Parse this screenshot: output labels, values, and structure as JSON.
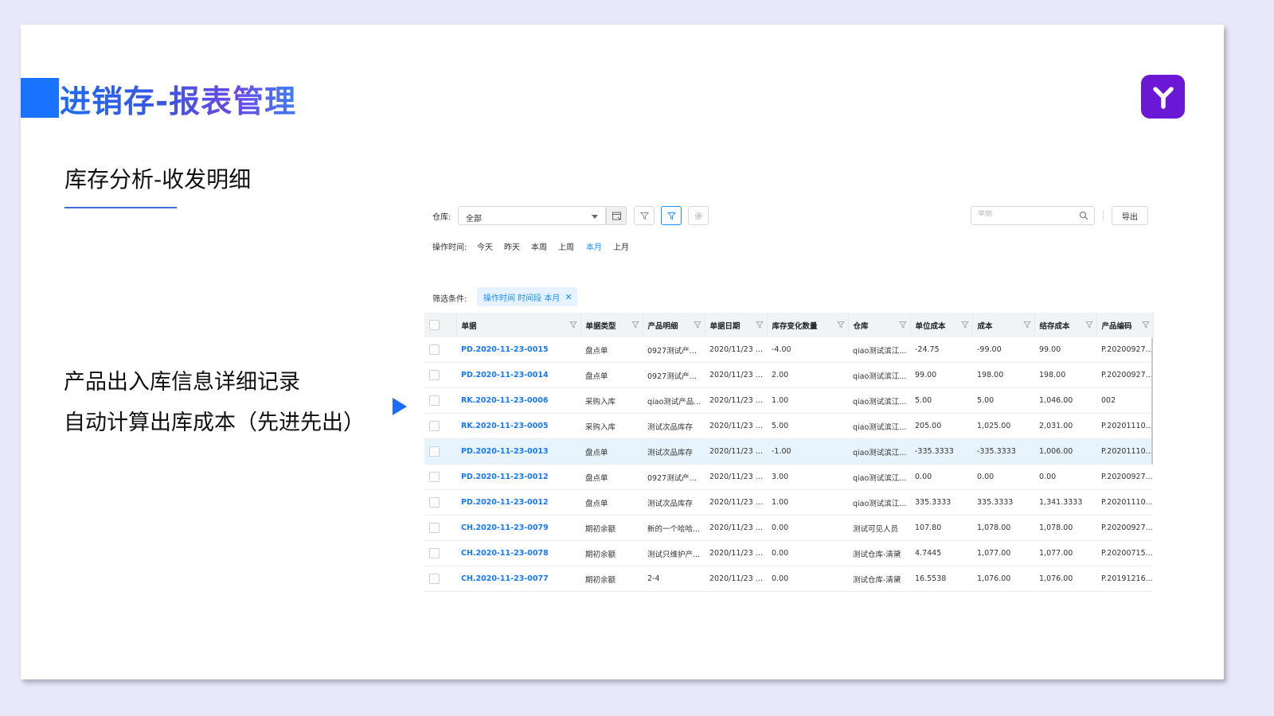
{
  "slide": {
    "title": "进销存-报表管理",
    "subtitle": "库存分析-收发明细",
    "desc_lines": [
      "产品出入库信息详细记录",
      "自动计算出库成本（先进先出）"
    ],
    "logo_icon": "y-logo-icon"
  },
  "toolbar": {
    "warehouse_label": "仓库:",
    "warehouse_value": "全部",
    "search_placeholder": "单据",
    "export_label": "导出"
  },
  "time_filter": {
    "label": "操作时间:",
    "options": [
      "今天",
      "昨天",
      "本周",
      "上周",
      "本月",
      "上月"
    ],
    "selected": "本月"
  },
  "filter": {
    "label": "筛选条件:",
    "tag": "操作时间 时间段 本月"
  },
  "table": {
    "headers": [
      "单据",
      "单据类型",
      "产品明细",
      "单据日期",
      "库存变化数量",
      "仓库",
      "单位成本",
      "成本",
      "结存成本",
      "产品编码"
    ],
    "rows": [
      {
        "no": "PD.2020-11-23-0015",
        "type": "盘点单",
        "product": "0927测试产...",
        "date": "2020/11/23 ...",
        "qty": "-4.00",
        "warehouse": "qiao测试滨江...",
        "unit_cost": "-24.75",
        "cost": "-99.00",
        "balance": "99.00",
        "code": "P.20200927..."
      },
      {
        "no": "PD.2020-11-23-0014",
        "type": "盘点单",
        "product": "0927测试产...",
        "date": "2020/11/23 ...",
        "qty": "2.00",
        "warehouse": "qiao测试滨江...",
        "unit_cost": "99.00",
        "cost": "198.00",
        "balance": "198.00",
        "code": "P.20200927..."
      },
      {
        "no": "RK.2020-11-23-0006",
        "type": "采购入库",
        "product": "qiao测试产品...",
        "date": "2020/11/23 ...",
        "qty": "1.00",
        "warehouse": "qiao测试滨江...",
        "unit_cost": "5.00",
        "cost": "5.00",
        "balance": "1,046.00",
        "code": "002"
      },
      {
        "no": "RK.2020-11-23-0005",
        "type": "采购入库",
        "product": "测试次品库存",
        "date": "2020/11/23 ...",
        "qty": "5.00",
        "warehouse": "qiao测试滨江...",
        "unit_cost": "205.00",
        "cost": "1,025.00",
        "balance": "2,031.00",
        "code": "P.20201110..."
      },
      {
        "no": "PD.2020-11-23-0013",
        "type": "盘点单",
        "product": "测试次品库存",
        "date": "2020/11/23 ...",
        "qty": "-1.00",
        "warehouse": "qiao测试滨江...",
        "unit_cost": "-335.3333",
        "cost": "-335.3333",
        "balance": "1,006.00",
        "code": "P.20201110..."
      },
      {
        "no": "PD.2020-11-23-0012",
        "type": "盘点单",
        "product": "0927测试产...",
        "date": "2020/11/23 ...",
        "qty": "3.00",
        "warehouse": "qiao测试滨江...",
        "unit_cost": "0.00",
        "cost": "0.00",
        "balance": "0.00",
        "code": "P.20200927..."
      },
      {
        "no": "PD.2020-11-23-0012",
        "type": "盘点单",
        "product": "测试次品库存",
        "date": "2020/11/23 ...",
        "qty": "1.00",
        "warehouse": "qiao测试滨江...",
        "unit_cost": "335.3333",
        "cost": "335.3333",
        "balance": "1,341.3333",
        "code": "P.20201110..."
      },
      {
        "no": "CH.2020-11-23-0079",
        "type": "期初余额",
        "product": "新的一个哈哈...",
        "date": "2020/11/23 ...",
        "qty": "0.00",
        "warehouse": "测试可见人员",
        "unit_cost": "107.80",
        "cost": "1,078.00",
        "balance": "1,078.00",
        "code": "P.20200927..."
      },
      {
        "no": "CH.2020-11-23-0078",
        "type": "期初余额",
        "product": "测试只维护产...",
        "date": "2020/11/23 ...",
        "qty": "0.00",
        "warehouse": "测试仓库-清黛",
        "unit_cost": "4.7445",
        "cost": "1,077.00",
        "balance": "1,077.00",
        "code": "P.20200715..."
      },
      {
        "no": "CH.2020-11-23-0077",
        "type": "期初余额",
        "product": "2-4",
        "date": "2020/11/23 ...",
        "qty": "0.00",
        "warehouse": "测试仓库-清黛",
        "unit_cost": "16.5538",
        "cost": "1,076.00",
        "balance": "1,076.00",
        "code": "P.20191216..."
      }
    ],
    "highlighted_row": 4
  }
}
